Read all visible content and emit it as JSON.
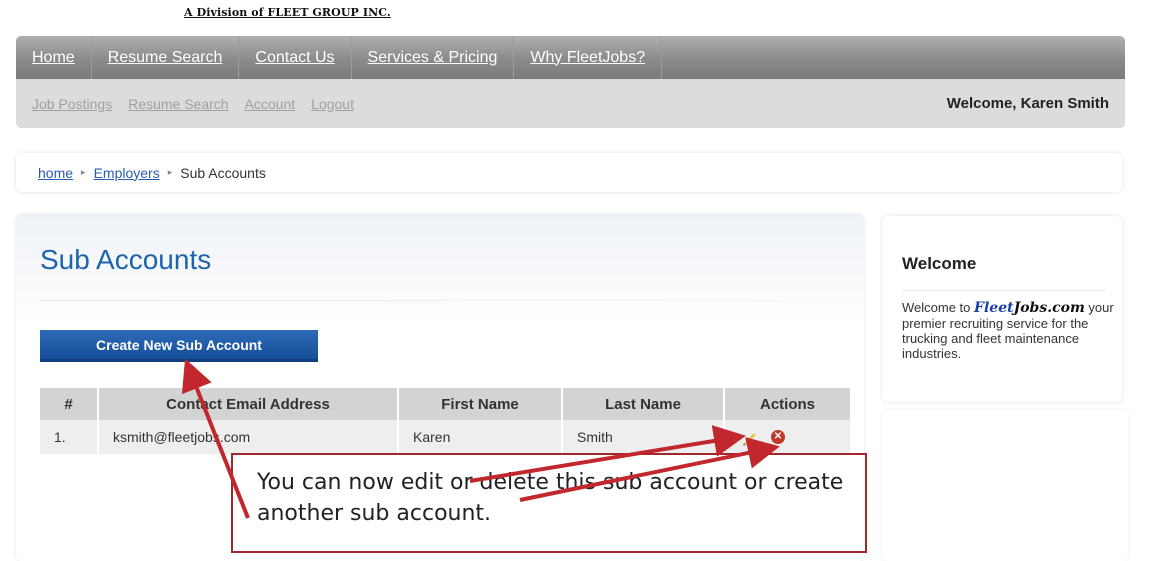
{
  "header": {
    "division_text": "A Division of FLEET GROUP INC."
  },
  "main_nav": [
    "Home",
    "Resume Search",
    "Contact Us",
    "Services & Pricing",
    "Why FleetJobs?"
  ],
  "sub_nav": {
    "links": [
      "Job Postings",
      "Resume Search",
      "Account",
      "Logout"
    ],
    "welcome": "Welcome, Karen Smith"
  },
  "breadcrumb": {
    "home": "home",
    "employers": "Employers",
    "current": "Sub Accounts"
  },
  "main": {
    "title": "Sub Accounts",
    "create_button": "Create New Sub Account",
    "table": {
      "headers": [
        "#",
        "Contact Email Address",
        "First Name",
        "Last Name",
        "Actions"
      ],
      "rows": [
        {
          "num": "1.",
          "email": "ksmith@fleetjobs.com",
          "first": "Karen",
          "last": "Smith"
        }
      ]
    }
  },
  "sidebar": {
    "title": "Welcome",
    "text_before": "Welcome to",
    "brand_part1": "Fleet",
    "brand_part2": "Jobs.com",
    "text_after": "your premier recruiting service for the trucking and fleet maintenance industries."
  },
  "callout": {
    "text": "You can now edit or delete this sub account or create another sub account.",
    "color": "#a3262b"
  },
  "colors": {
    "accent": "#1d63ad",
    "button": "#1f5aa8",
    "nav": "#8d8d8d",
    "delete": "#c0392b"
  }
}
